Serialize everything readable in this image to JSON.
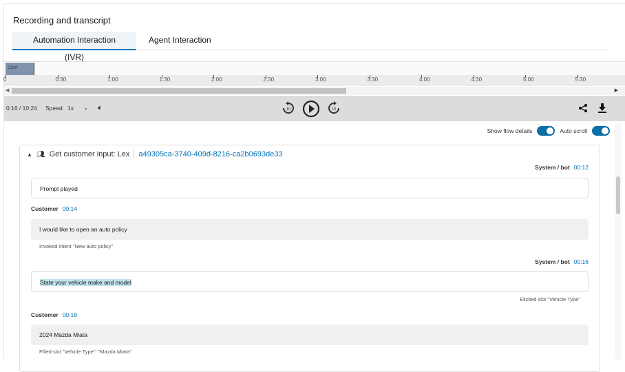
{
  "section_title": "Recording and transcript",
  "tabs": [
    {
      "label": "Automation Interaction (IVR)",
      "active": true
    },
    {
      "label": "Agent Interaction",
      "active": false
    }
  ],
  "timeline": {
    "start_label": "Start",
    "ticks": [
      "0",
      "0:30",
      "1:00",
      "1:30",
      "2:00",
      "2:30",
      "3:00",
      "3:30",
      "4:00",
      "4:30",
      "5:00",
      "5:30"
    ]
  },
  "player": {
    "time": "0:16 / 10:24",
    "speed_label": "Speed:",
    "speed_value": "1x",
    "skip_back": "10",
    "skip_forward": "10"
  },
  "toggles": {
    "flow_details": {
      "label": "Show flow details",
      "on": true
    },
    "auto_scroll": {
      "label": "Auto scroll",
      "on": true
    }
  },
  "block": {
    "title": "Get customer input: Lex",
    "id": "a49305ca-3740-409d-8216-ca2b0693de33"
  },
  "transcript": [
    {
      "speaker": "System / bot",
      "time": "00:12",
      "text": "Prompt played"
    },
    {
      "speaker": "Customer",
      "time": "00:14",
      "text": "I would like to open an auto policy",
      "note": "Invoked intent \"New auto policy\""
    },
    {
      "speaker": "System / bot",
      "time": "00:16",
      "text": "State your vehicle make and model",
      "note": "Elicited slot \"Vehicle Type\""
    },
    {
      "speaker": "Customer",
      "time": "00:18",
      "text": "2024 Mazda Miata",
      "note": "Filled slot \"Vehicle Type\": \"Mazda Miata\""
    }
  ],
  "colors": {
    "accent": "#0073bb",
    "toggle": "#0b6ea4"
  }
}
